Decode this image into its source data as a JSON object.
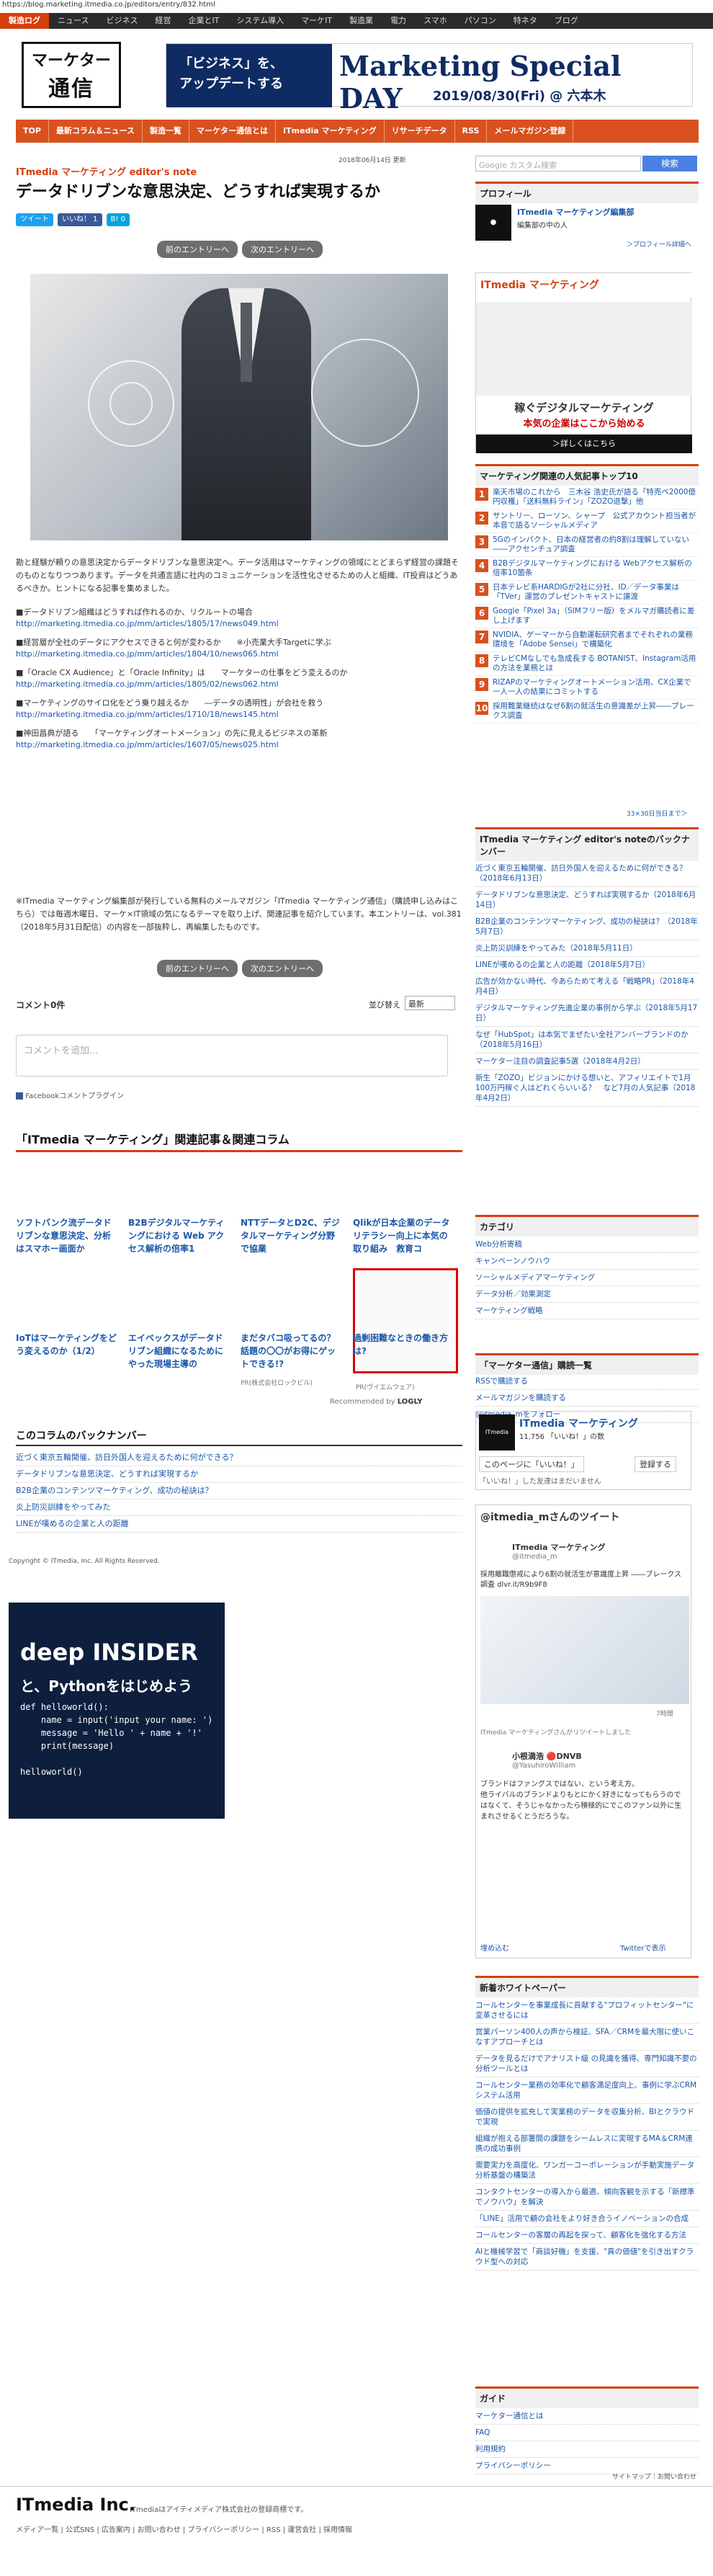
{
  "url": "https://blog.marketing.itmedia.co.jp/editors/entry/832.html",
  "topnav": [
    "製造ログ",
    "ニュース",
    "ビジネス",
    "経営",
    "企業とIT",
    "システム導入",
    "マーケIT",
    "製造業",
    "電力",
    "スマホ",
    "パソコン",
    "特ネタ",
    "ブログ"
  ],
  "logo": {
    "line1": "マーケター",
    "line2": "通信"
  },
  "banner": {
    "left_line1": "「ビジネス」を、",
    "left_line2": "アップデートする",
    "title": "Marketing Special DAY",
    "date": "2019/08/30(Fri) @ 六本木"
  },
  "subnav": [
    "TOP",
    "最新コラム＆ニュース",
    "製造一覧",
    "マーケター通信とは",
    "ITmedia マーケティング",
    "リサーチデータ",
    "RSS",
    "メールマガジン登録"
  ],
  "date_text": "2018年06月14日 更新",
  "search": {
    "placeholder": "Google カスタム検索",
    "button": "検索"
  },
  "article": {
    "column": "ITmedia マーケティング editor's note",
    "title": "データドリブンな意思決定、どうすれば実現するか",
    "share": {
      "tweet": "ツイート",
      "like": "いいね！ 1",
      "hatebu": "B! 0"
    },
    "prev": "前のエントリーへ",
    "next": "次のエントリーへ",
    "lead": "勘と経験が頼りの意思決定からデータドリブンな意思決定へ。データ活用はマーケティングの領域にとどまらず経営の課題そのものとなりつつあります。データを共通言語に社内のコミュニケーションを活性化させるための人と組織、IT投資はどうあるべきか。ヒントになる記事を集めました。",
    "links": [
      {
        "title": "■データドリブン組織はどうすれば作れるのか、リクルートの場合",
        "url": "http://marketing.itmedia.co.jp/mm/articles/1805/17/news049.html"
      },
      {
        "title": "■経営層が全社のデータにアクセスできると何が変わるか　　※小売業大手Targetに学ぶ",
        "url": "http://marketing.itmedia.co.jp/mm/articles/1804/10/news065.html"
      },
      {
        "title": "■「Oracle CX Audience」と「Oracle Infinity」は　　マーケターの仕事をどう変えるのか",
        "url": "http://marketing.itmedia.co.jp/mm/articles/1805/02/news062.html"
      },
      {
        "title": "■マーケティングのサイロ化をどう乗り越えるか　　―データの透明性」が会社を救う",
        "url": "http://marketing.itmedia.co.jp/mm/articles/1710/18/news145.html"
      },
      {
        "title": "■神田昌典が語る　　「マーケティングオートメーション」の先に見えるビジネスの革新",
        "url": "http://marketing.itmedia.co.jp/mm/articles/1607/05/news025.html"
      }
    ],
    "footnote": "※ITmedia マーケティング編集部が発行している無料のメールマガジン「ITmedia マーケティング通信」（購読申し込みはこちら）では毎週木曜日、マーケ×IT領域の気になるテーマを取り上げ、関連記事を紹介しています。本エントリーは、vol.381（2018年5月31日配信）の内容を一部抜粋し、再編集したものです。"
  },
  "comments": {
    "count": "コメント0件",
    "sort_label": "並び替え",
    "sort_value": "最新",
    "placeholder": "コメントを追加...",
    "plugin": "Facebookコメントプラグイン"
  },
  "related": {
    "title": "「ITmedia マーケティング」関連記事＆関連コラム",
    "row1": [
      "ソフトバンク流データドリブンな意思決定、分析はスマホー画面か",
      "B2Bデジタルマーケティングにおける Web アクセス解析の倍率1",
      "NTTデータとD2C、デジタルマーケティング分野で協業",
      "Qlikが日本企業のデータリテラシー向上に本気の取り組み　救育コ"
    ],
    "row2": [
      "IoTはマーケティングをどう変えるのか（1/2）",
      "エイベックスがデータドリブン組織になるためにやった現場主導の",
      "まだタバコ吸ってるの？話題の〇〇がお得にゲットできる!?",
      "過剰困難なときの働き方は?"
    ],
    "sponsor1": "PR(株式会社ロックビル)",
    "sponsor2": "PR(ヴイエムウェア)",
    "recommended": "Recommended by",
    "logly": "LOGLY"
  },
  "backnumber": {
    "title": "このコラムのバックナンバー",
    "items": [
      "近づく東京五輪開催、訪日外国人を迎えるために何ができる？",
      "データドリブンな意思決定、どうすれば実現するか",
      "B2B企業のコンテンツマーケティング、成功の秘訣は？",
      "炎上防災訓練をやってみた",
      "LINEが嘆めるの企業と人の距離"
    ]
  },
  "copyright": "Copyright © ITmedia, Inc. All Rights Reserved.",
  "ad_deep": {
    "brand": "deep INSIDER",
    "line1": "と、Pythonをはじめよう",
    "code": [
      "def helloworld():",
      "    name = input('input your name: ')",
      "    message = 'Hello ' + name + '!'",
      "    print(message)",
      "",
      "helloworld()"
    ]
  },
  "sidebar": {
    "profile_title": "プロフィール",
    "profile_name": "ITmedia マーケティング編集部",
    "profile_sub": "編集部の中の人",
    "profile_more": "＞プロフィール詳細へ",
    "ad_title": "稼ぐデジタルマーケティング",
    "ad_sub": "本気の企業はここから始める",
    "ad_more": "＞詳しくはこちら",
    "ranking_title": "マーケティング関連の人気記事トップ10",
    "ranking": [
      "楽天市場のこれから　三木谷 浩史氏が語る「特売ペ2000億円収穫」「送料無料ライン」「ZOZO退撃」他",
      "サントリー、ローソン、シャープ　公式アカウント担当者が本音で語るソーシャルメディア",
      "5Gのインパクト、日本の経営者の約8割は理解していない――アクセンチュア調査",
      "B2Bデジタルマーケティングにおける Webアクセス解析の倍率10箇条",
      "日本テレビ系HARDIGが2社に分社、ID／データ事業は「TVer」運営のプレゼントキャストに譲渡",
      "Google「Pixel 3a」（SIMフリー版）をメルマガ購読者に差し上げます",
      "NVIDIA、ゲーマーから自動運転研究者までそれぞれの業務環境を「Adobe Sensei」で構築化",
      "テレビCMなしでも急成長する BOTANIST、Instagram活用の方法を業務とは",
      "RIZAPのマーケティングオートメーション活用、CX企業で一人一人の結果にコミットする",
      "採用難業継続はなぜ6割の就活生の意識差が上昇――ブレークス調査"
    ],
    "ranking_footer": "33×30日当日まで＞",
    "backnum_title": "ITmedia マーケティング editor's noteのバックナンバー",
    "backnum": [
      "近づく東京五輪開催、訪日外国人を迎えるために何ができる？（2018年6月13日）",
      "データドリブンな意思決定、どうすれば実現するか（2018年6月14日）",
      "B2B企業のコンテンツマーケティング、成功の秘訣は？（2018年5月7日）",
      "炎上防災訓練をやってみた（2018年5月11日）",
      "LINEが嘆めるの企業と人の距離（2018年5月7日）",
      "広告が効かない時代、今あらためて考える「戦略PR」（2018年4月4日）",
      "デジタルマーケティング先進企業の事例から学ぶ（2018年5月17日）",
      "なぜ「HubSpot」は本気でまぜたい全社アンバーブランドのか（2018年5月16日）",
      "マーケター注目の調査記事5選（2018年4月2日）",
      "新生「ZOZO」ビジョンにかける想いと、アフィリエイトで1月100万円稼ぐ人はどれくらいいる？　など7月の人気記事（2018年4月2日）"
    ],
    "category_title": "カテゴリ",
    "categories": [
      "Web分析寄稿",
      "キャンペーンノウハウ",
      "ソーシャルメディアマーケティング",
      "データ分析／効果測定",
      "マーケティング戦略"
    ],
    "subscribe_title": "「マーケター通信」購読一覧",
    "subscribe": [
      "RSSで購読する",
      "メールマガジンを購読する",
      "@itmedia_mをフォロー"
    ],
    "fb_name": "ITmedia マーケティング",
    "fb_likes": "11,756 「いいね！」の数",
    "fb_like_btn": "このページに「いいね！」",
    "fb_reg": "登録する",
    "fb_note": "「いいね！」した友達はまだいません",
    "twitter_title": "@itmedia_mさんのツイート",
    "tw_account": "ITmedia マーケティング",
    "tw_handle": "@itmedia_m",
    "tw_text": "採用離職懲戒により6割の就活生が意識度上昇 ――ブレークス調査 dlvr.it/R9b9F8",
    "tw_time": "7時間",
    "tw_rt_by": "ITmedia マーケティングさんがリツイートしました",
    "tw_rt_name": "小根満浩 🔴DNVB",
    "tw_rt_handle": "@YasuhiroWilliam",
    "tw_rt_text": "ブランドはファングスではない、という考え方。\n他ライバルのブランドよりもとにかく好きになってもらうのではなくて、そうじゃなかったら積極的にでこのファン以外に生まれさせるくとうだろうな。",
    "tw_embed": "埋め込む",
    "tw_view": "Twitterで表示",
    "wp_title": "新着ホワイトペーパー",
    "wp": [
      "コールセンターを事業成長に貢献する\"プロフィットセンター\"に変革させるには",
      "営業パーソン400人の声から検証、SFA／CRMを最大限に使いこなすアプローチとは",
      "データを見るだけでアナリスト級 の見識を獲得、専門知識不要の分析ツールとは",
      "コールセンター業務の効率化で顧客満足度向上、事例に学ぶCRMシステム活用",
      "価値の提供を拡充して実業務のデータを収集分析、BIとクラウドで実現",
      "組織が抱える部署間の課題をシームレスに実現するMA＆CRM連携の成功事例",
      "需要実力を高度化、ワンガーコーポレーションが手動実施データ分析基盤の構築法",
      "コンタクトセンターの導入から最適、傾向客観を示する「新標準でノウハウ」を解決",
      "「LINE」活用で顧の会社をより好き合うイノベーションの合成",
      "コールセンターの客層の再起を探って、顧客化を強化する方法",
      "AIと機械学習で「商談好機」を支援、\"真の価値\"を引き出すクラウド型への対応"
    ],
    "guide_title": "ガイド",
    "guide": [
      "マーケター通信とは",
      "FAQ",
      "利用規約",
      "プライバシーポリシー"
    ]
  },
  "footer": {
    "sitemap": "サイトマップ｜お問い合わせ",
    "logo": "ITmedia Inc.",
    "trademark": "ITmediaはアイティメディア株式会社の登録商標です。",
    "links": "メディア一覧 | 公式SNS | 広告案内 | お問い合わせ | プライバシーポリシー | RSS | 運営会社 | 採用情報"
  }
}
